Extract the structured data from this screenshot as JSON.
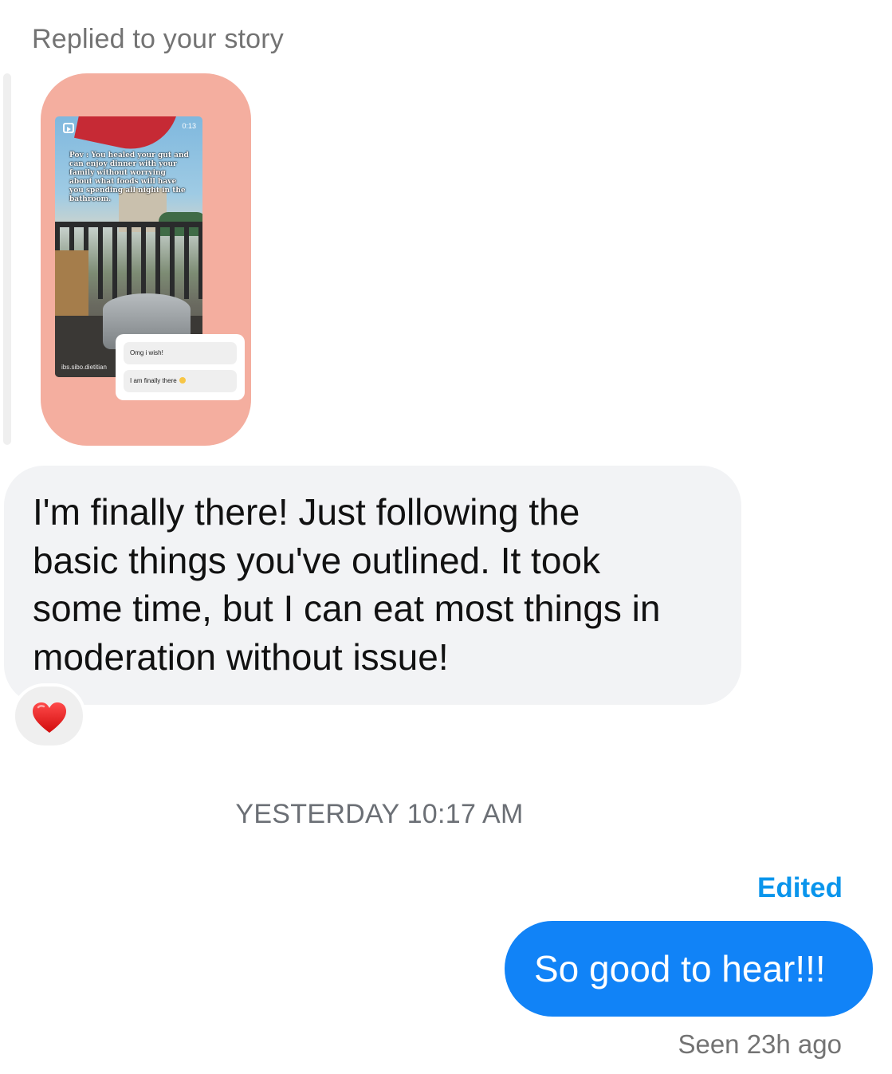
{
  "story_reply": {
    "label": "Replied to your story",
    "card_color": "#f4ae9f",
    "story": {
      "time": "0:13",
      "caption": "Pov : You healed your gut and can enjoy dinner with your family without worrying about what foods will have you spending all night in the bathroom.",
      "username": "ibs.sibo.dietitian",
      "reel_icon": "reel-icon",
      "poll": {
        "options": [
          "Omg i wish!",
          "I am finally there"
        ],
        "emoji": "grinning-face-icon"
      }
    }
  },
  "incoming_message": {
    "text": "I'm finally there! Just following the\nbasic things you've outlined. It took\nsome time, but I can eat most things in\nmoderation without issue!",
    "reaction": "red-heart-icon",
    "bubble_color": "#f2f3f5"
  },
  "timestamp": "YESTERDAY 10:17 AM",
  "outgoing_message": {
    "edited_label": "Edited",
    "text": "So good to hear!!!",
    "status": "Seen 23h ago",
    "bubble_color": "#1183f7",
    "edited_color": "#0a95ec"
  }
}
